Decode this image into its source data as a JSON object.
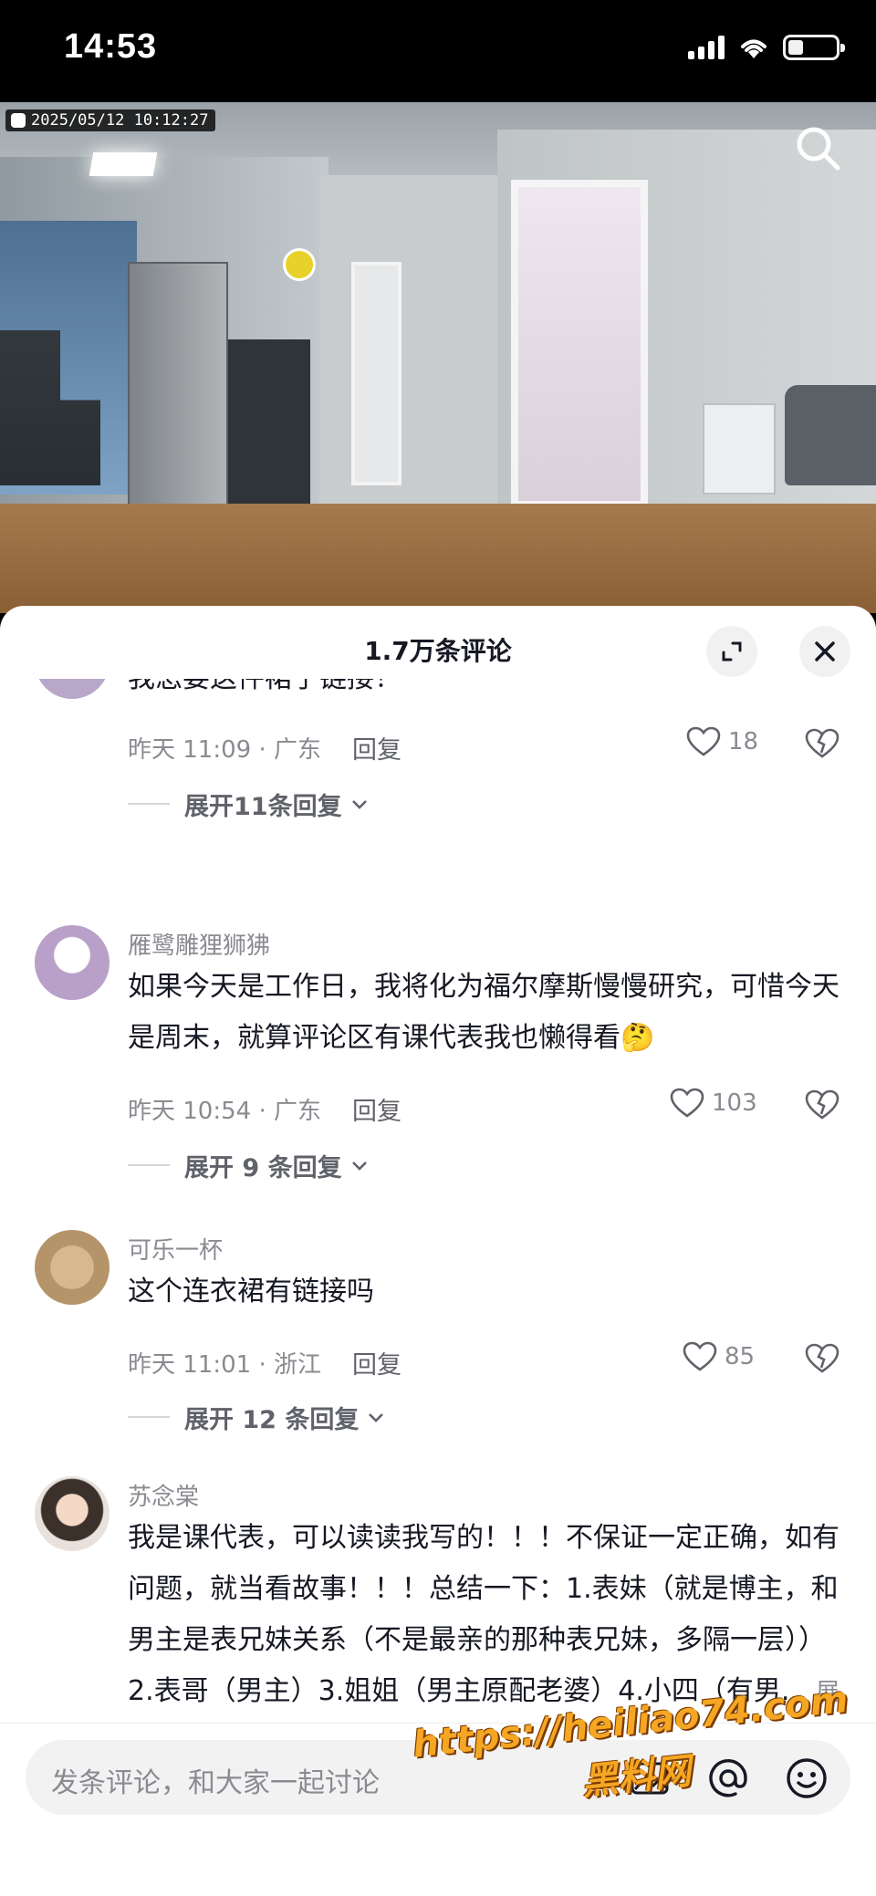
{
  "status_bar": {
    "time": "14:53"
  },
  "video": {
    "timestamp": "2025/05/12 10:12:27"
  },
  "sheet": {
    "title": "1.7万条评论"
  },
  "comments": [
    {
      "partial_text": "我怎要这件裙子链接！",
      "time_location": "昨天 11:09 · 广东",
      "reply_label": "回复",
      "likes": "18",
      "more_replies": "展开11条回复"
    },
    {
      "username": "雁鹭雕狸狮狒",
      "text": "如果今天是工作日，我将化为福尔摩斯慢慢研究，可惜今天是周末，就算评论区有课代表我也懒得看🤔",
      "time_location": "昨天 10:54 · 广东",
      "reply_label": "回复",
      "likes": "103",
      "more_replies": "展开 9 条回复"
    },
    {
      "username": "可乐一杯",
      "text": "这个连衣裙有链接吗",
      "time_location": "昨天 11:01 · 浙江",
      "reply_label": "回复",
      "likes": "85",
      "more_replies": "展开 12 条回复"
    },
    {
      "username": "苏念棠",
      "text": "我是课代表，可以读读我写的！！！不保证一定正确，如有问题，就当看故事！！！总结一下：1.表妹（就是博主，和男主是表兄妹关系（不是最亲的那种表兄妹，多隔一层））2.表哥（男主）3.姐姐（男主原配老婆）4.小四（有男...",
      "expand_label": "展开"
    }
  ],
  "input": {
    "placeholder": "发条评论，和大家一起讨论"
  },
  "watermark": {
    "line1": "https://heiliao74.com",
    "line2": "黑料网"
  },
  "icons": {
    "search": "search-icon",
    "expand": "expand-icon",
    "close": "close-icon",
    "heart": "heart-icon",
    "broken_heart": "broken-heart-icon",
    "chevron": "chevron-down-icon",
    "image": "image-icon",
    "at": "at-icon",
    "emoji": "emoji-icon"
  },
  "colors": {
    "text_primary": "#161823",
    "text_secondary": "#8a8b91",
    "watermark": "#f5a623"
  }
}
